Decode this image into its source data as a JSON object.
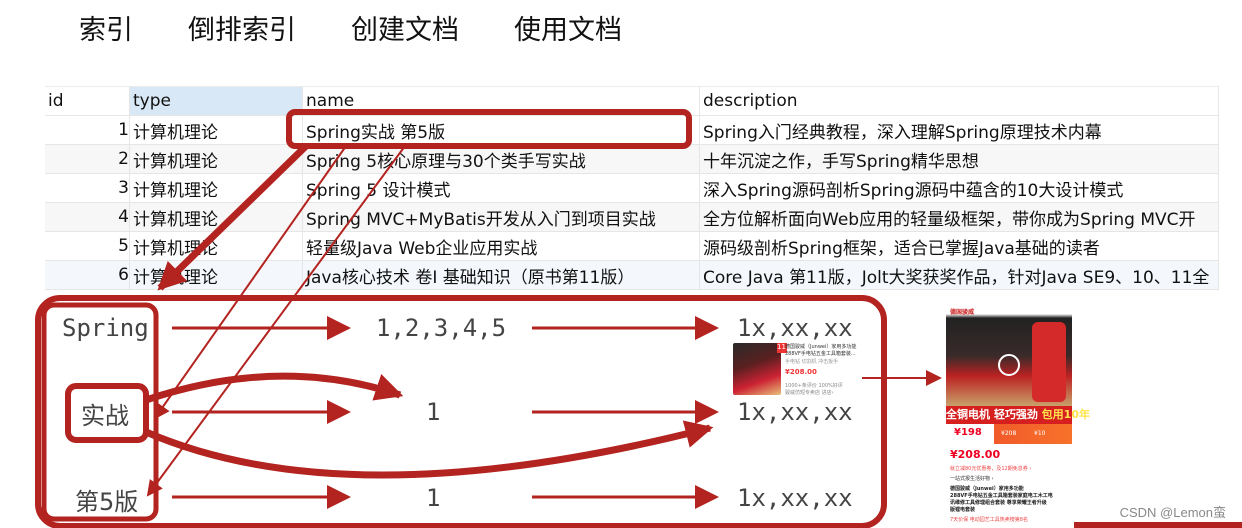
{
  "tabs": [
    "索引",
    "倒排索引",
    "创建文档",
    "使用文档"
  ],
  "table": {
    "columns": [
      "id",
      "type",
      "name",
      "description"
    ],
    "selected_column": "type",
    "rows": [
      {
        "id": "1",
        "type": "计算机理论",
        "name": "Spring实战 第5版",
        "description": "Spring入门经典教程，深入理解Spring原理技术内幕"
      },
      {
        "id": "2",
        "type": "计算机理论",
        "name": "Spring 5核心原理与30个类手写实战",
        "description": "十年沉淀之作，手写Spring精华思想"
      },
      {
        "id": "3",
        "type": "计算机理论",
        "name": "Spring 5 设计模式",
        "description": "深入Spring源码剖析Spring源码中蕴含的10大设计模式"
      },
      {
        "id": "4",
        "type": "计算机理论",
        "name": "Spring MVC+MyBatis开发从入门到项目实战",
        "description": "全方位解析面向Web应用的轻量级框架，带你成为Spring MVC开"
      },
      {
        "id": "5",
        "type": "计算机理论",
        "name": "轻量级Java Web企业应用实战",
        "description": "源码级剖析Spring框架，适合已掌握Java基础的读者"
      },
      {
        "id": "6",
        "type": "计算机理论",
        "name": "Java核心技术 卷I 基础知识（原书第11版）",
        "description": "Core Java 第11版，Jolt大奖获奖作品，针对Java SE9、10、11全"
      }
    ]
  },
  "inverted_index": {
    "entries": [
      {
        "term": "Spring",
        "postings": "1,2,3,4,5",
        "doc": "1x,xx,xx"
      },
      {
        "term": "实战",
        "postings": "1",
        "doc": "1x,xx,xx"
      },
      {
        "term": "第5版",
        "postings": "1",
        "doc": "1x,xx,xx"
      }
    ]
  },
  "thumbnail": {
    "title_line1": "德国骏威（Junwei）家用多功能",
    "title_line2": "288VF手电钻五金工具箱套装...",
    "tags": "手电钻  切割机  冲击扳手",
    "price": "¥208.00",
    "reviews": "1000+条评价  100%好评",
    "shop": "骏威仿短专卖店  进店›",
    "badge": "11"
  },
  "product": {
    "brand": "德国骏威",
    "banner_white": "全铜电机 轻巧强劲 ",
    "banner_yellow": "包用10年",
    "deal_price": "¥198",
    "orig_price": "¥208",
    "discount": "¥10",
    "price": "¥208.00",
    "promo": "就立减80元优惠券，及12期免息券 ›",
    "tag_line": "一站式报生活好物 ›",
    "title_lines": [
      "德国骏威（Junwei）家用多功能",
      "288VF手电钻五金工具箱套装家庭电工木工电",
      "讯维修工具修理组合套装 尊享荣耀王者升级",
      "版锂电套装"
    ],
    "footer": "7天价保   电动园艺工具热卖榜第8名"
  },
  "colors": {
    "accent": "#b3231f",
    "text": "#444444",
    "header_selected": "#d9e8f6"
  },
  "watermark": "CSDN @Lemon蛮"
}
